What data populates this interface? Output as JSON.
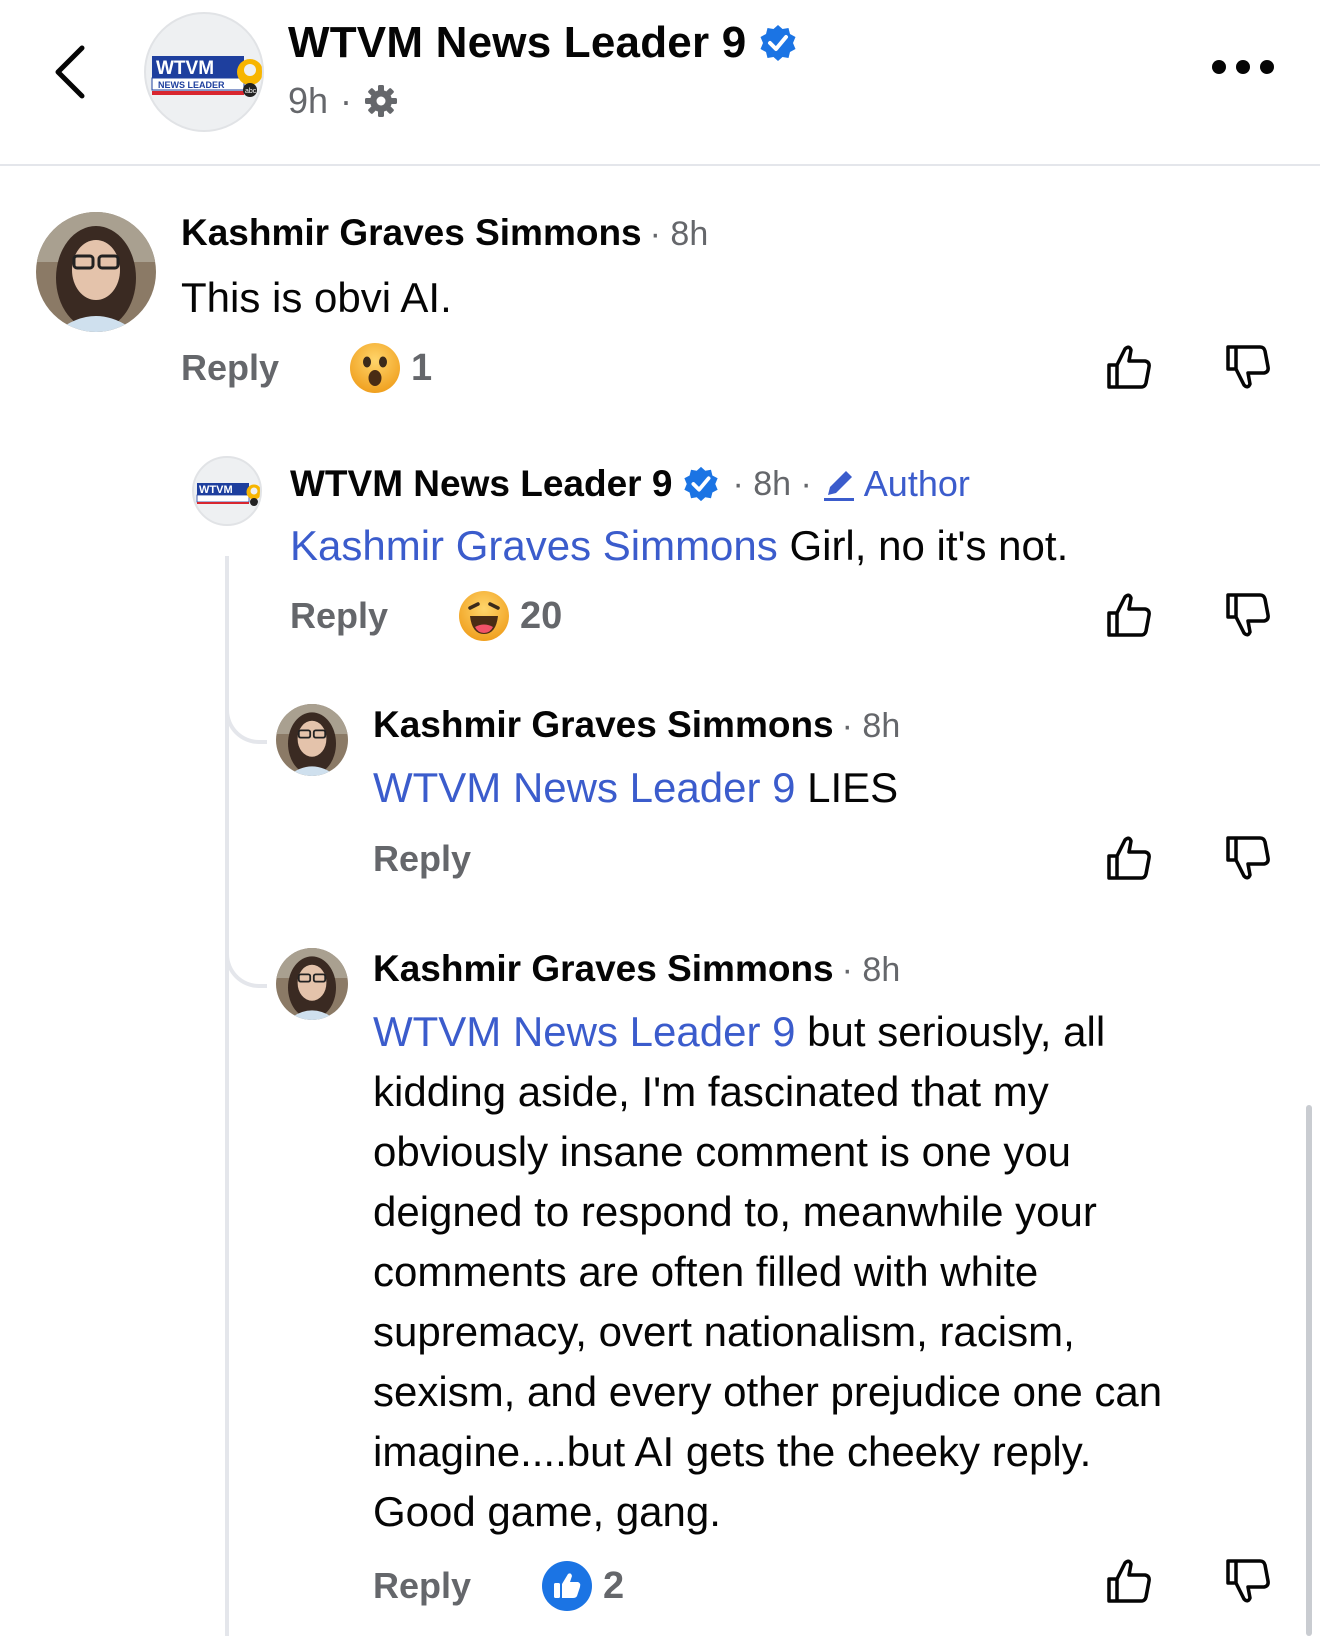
{
  "header": {
    "page_name": "WTVM News Leader 9",
    "time": "9h",
    "separator": "·",
    "logo_text": "WTVM",
    "logo_sub": "NEWS LEADER",
    "logo_network": "abc"
  },
  "comments": [
    {
      "author": "Kashmir Graves Simmons",
      "time": "· 8h",
      "text": "This is obvi AI.",
      "reply_label": "Reply",
      "reaction_icon": "wow-emoji-icon",
      "reaction_count": "1"
    },
    {
      "author": "WTVM News Leader 9",
      "time": "· 8h ·",
      "author_tag": "Author",
      "mention": "Kashmir Graves Simmons",
      "text": " Girl, no it's not.",
      "reply_label": "Reply",
      "reaction_icon": "haha-emoji-icon",
      "reaction_count": "20"
    },
    {
      "author": "Kashmir Graves Simmons",
      "time": "· 8h",
      "mention": "WTVM News Leader 9",
      "text": " LIES",
      "reply_label": "Reply"
    },
    {
      "author": "Kashmir Graves Simmons",
      "time": "· 8h",
      "mention": "WTVM News Leader 9",
      "lines": [
        " but seriously, all",
        "kidding aside, I'm fascinated that my",
        "obviously insane comment is one you",
        "deigned to respond to, meanwhile your",
        "comments are often filled with white",
        "supremacy, overt nationalism, racism,",
        "sexism, and every other prejudice one can",
        "imagine....but AI gets the cheeky reply.",
        "Good game, gang."
      ],
      "reply_label": "Reply",
      "reaction_icon": "like-reaction-icon",
      "reaction_count": "2"
    }
  ],
  "colors": {
    "mention": "#3b5ccc",
    "verified": "#1b74e4",
    "muted": "#65676b"
  }
}
